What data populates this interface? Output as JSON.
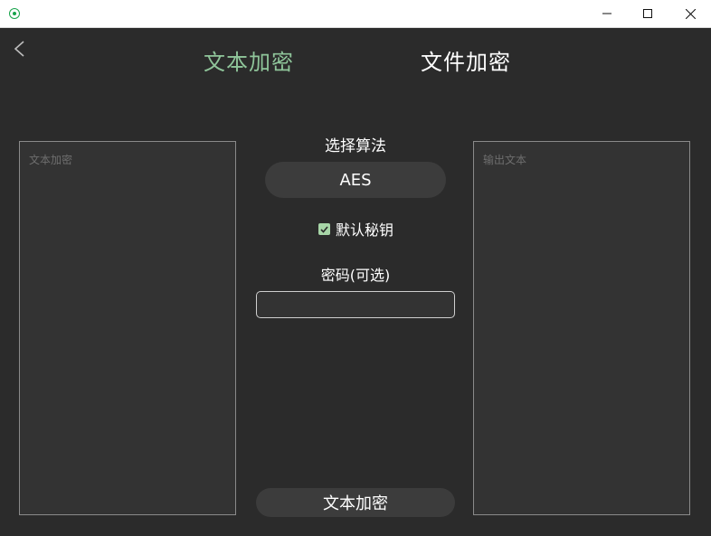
{
  "tabs": {
    "text_encrypt": "文本加密",
    "file_encrypt": "文件加密"
  },
  "input_panel": {
    "placeholder": "文本加密"
  },
  "output_panel": {
    "placeholder": "输出文本"
  },
  "algorithm": {
    "label": "选择算法",
    "selected": "AES"
  },
  "default_key": {
    "label": "默认秘钥",
    "checked": true
  },
  "password": {
    "label": "密码(可选)",
    "value": ""
  },
  "action": {
    "label": "文本加密"
  },
  "colors": {
    "active_tab": "#8fc59a",
    "background": "#2b2b2b",
    "checkbox": "#a7d5a7"
  },
  "icons": {
    "app": "app-icon",
    "back": "chevron-left-icon",
    "minimize": "minimize-icon",
    "maximize": "maximize-icon",
    "close": "close-icon",
    "check": "checkmark-icon"
  }
}
